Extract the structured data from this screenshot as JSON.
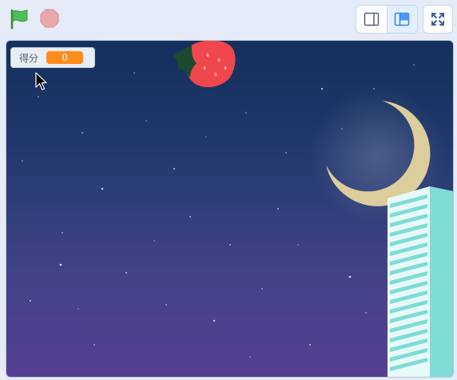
{
  "toolbar": {
    "green_flag_icon": "green-flag-icon",
    "stop_icon": "stop-icon",
    "small_stage_icon": "small-stage-icon",
    "large_stage_icon": "large-stage-icon",
    "fullscreen_icon": "fullscreen-icon"
  },
  "monitor": {
    "label": "得分",
    "value": "0"
  },
  "colors": {
    "sky_top": "#14305e",
    "sky_bottom": "#553f92",
    "moon": "#dccd9c",
    "building": "#7fdcd6",
    "strawberry": "#f0474c",
    "monitor_value_bg": "#ff8c1a"
  },
  "sprites": [
    "strawberry-sprite",
    "moon-sprite",
    "building-sprite"
  ]
}
